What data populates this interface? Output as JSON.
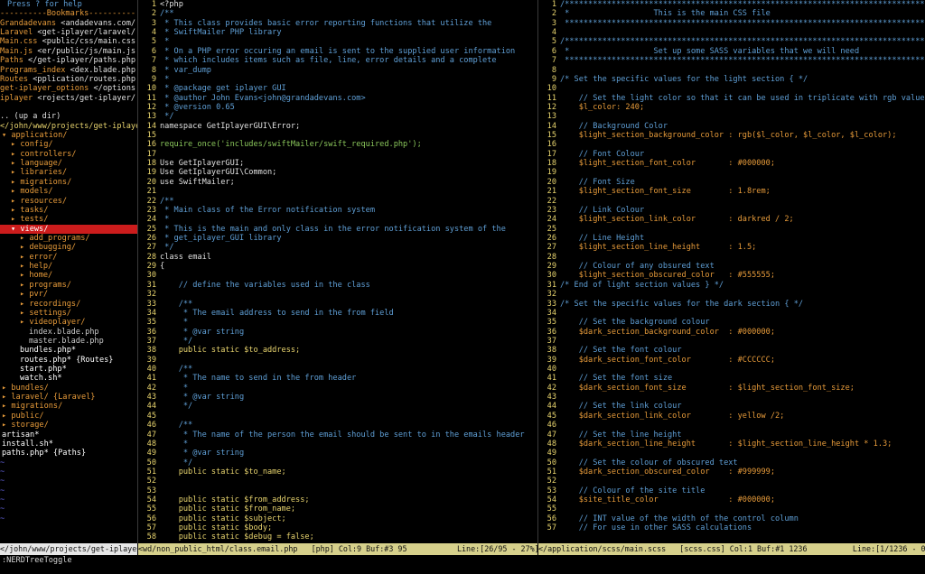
{
  "left_pane": {
    "help": "Press ? for help",
    "bookmarks_header": "----------Bookmarks----------",
    "bookmarks": [
      {
        "name": "Grandadevans",
        "path": "<andadevans.com/"
      },
      {
        "name": "Laravel",
        "path": "<get-iplayer/laravel/"
      },
      {
        "name": "Main.css",
        "path": "<public/css/main.css"
      },
      {
        "name": "Main.js",
        "path": "<er/public/js/main.js"
      },
      {
        "name": "Paths",
        "path": "</get-iplayer/paths.php"
      },
      {
        "name": "Programs_index",
        "path": "<dex.blade.php"
      },
      {
        "name": "Routes",
        "path": "<pplication/routes.php"
      },
      {
        "name": "get-iplayer_options",
        "path": "</options"
      },
      {
        "name": "iplayer",
        "path": "<rojects/get-iplayer/"
      }
    ],
    "up_dir": ".. (up a dir)",
    "cwd": "</john/www/projects/get-iplayer/",
    "tree": [
      {
        "text": "▾ application/",
        "indent": 0,
        "kind": "dir"
      },
      {
        "text": "▸ config/",
        "indent": 1,
        "kind": "dir"
      },
      {
        "text": "▸ controllers/",
        "indent": 1,
        "kind": "dir"
      },
      {
        "text": "▸ language/",
        "indent": 1,
        "kind": "dir"
      },
      {
        "text": "▸ libraries/",
        "indent": 1,
        "kind": "dir"
      },
      {
        "text": "▸ migrations/",
        "indent": 1,
        "kind": "dir"
      },
      {
        "text": "▸ models/",
        "indent": 1,
        "kind": "dir"
      },
      {
        "text": "▸ resources/",
        "indent": 1,
        "kind": "dir"
      },
      {
        "text": "▸ tasks/",
        "indent": 1,
        "kind": "dir"
      },
      {
        "text": "▸ tests/",
        "indent": 1,
        "kind": "dir"
      },
      {
        "text": "▾ views/",
        "indent": 1,
        "kind": "dir",
        "selected": true
      },
      {
        "text": "▸ add_programs/",
        "indent": 2,
        "kind": "dir"
      },
      {
        "text": "▸ debugging/",
        "indent": 2,
        "kind": "dir"
      },
      {
        "text": "▸ error/",
        "indent": 2,
        "kind": "dir"
      },
      {
        "text": "▸ help/",
        "indent": 2,
        "kind": "dir"
      },
      {
        "text": "▸ home/",
        "indent": 2,
        "kind": "dir"
      },
      {
        "text": "▸ programs/",
        "indent": 2,
        "kind": "dir"
      },
      {
        "text": "▸ pvr/",
        "indent": 2,
        "kind": "dir"
      },
      {
        "text": "▸ recordings/",
        "indent": 2,
        "kind": "dir"
      },
      {
        "text": "▸ settings/",
        "indent": 2,
        "kind": "dir"
      },
      {
        "text": "▸ videoplayer/",
        "indent": 2,
        "kind": "dir"
      },
      {
        "text": "index.blade.php",
        "indent": 3,
        "kind": "file"
      },
      {
        "text": "master.blade.php",
        "indent": 3,
        "kind": "file"
      },
      {
        "text": "bundles.php*",
        "indent": 2,
        "kind": "exec"
      },
      {
        "text": "routes.php* {Routes}",
        "indent": 2,
        "kind": "exec"
      },
      {
        "text": "start.php*",
        "indent": 2,
        "kind": "exec"
      },
      {
        "text": "watch.sh*",
        "indent": 2,
        "kind": "exec"
      },
      {
        "text": "▸ bundles/",
        "indent": 0,
        "kind": "dir"
      },
      {
        "text": "▸ laravel/ {Laravel}",
        "indent": 0,
        "kind": "dir"
      },
      {
        "text": "▸ migrations/",
        "indent": 0,
        "kind": "dir"
      },
      {
        "text": "▸ public/",
        "indent": 0,
        "kind": "dir"
      },
      {
        "text": "▸ storage/",
        "indent": 0,
        "kind": "dir"
      },
      {
        "text": "artisan*",
        "indent": 0,
        "kind": "exec"
      },
      {
        "text": "install.sh*",
        "indent": 0,
        "kind": "exec"
      },
      {
        "text": "paths.php* {Paths}",
        "indent": 0,
        "kind": "exec"
      }
    ],
    "tildes": 7
  },
  "middle_pane": {
    "lines": [
      {
        "n": "1",
        "c": "<?php",
        "s": "white"
      },
      {
        "n": "2",
        "c": "/**",
        "s": "blue"
      },
      {
        "n": "3",
        "c": " * This class provides basic error reporting functions that utilize the",
        "s": "blue"
      },
      {
        "n": "4",
        "c": " * SwiftMailer PHP library",
        "s": "blue"
      },
      {
        "n": "5",
        "c": " *",
        "s": "blue"
      },
      {
        "n": "6",
        "c": " * On a PHP error occuring an email is sent to the supplied user information",
        "s": "blue"
      },
      {
        "n": "7",
        "c": " * which includes items such as file, line, error details and a complete",
        "s": "blue"
      },
      {
        "n": "8",
        "c": " * var_dump",
        "s": "blue"
      },
      {
        "n": "9",
        "c": " *",
        "s": "blue"
      },
      {
        "n": "10",
        "c": " * @package get iplayer GUI",
        "s": "blue"
      },
      {
        "n": "11",
        "c": " * @author John Evans<john@grandadevans.com>",
        "s": "blue"
      },
      {
        "n": "12",
        "c": " * @version 0.65",
        "s": "blue"
      },
      {
        "n": "13",
        "c": " */",
        "s": "blue"
      },
      {
        "n": "14",
        "c": "namespace GetIplayerGUI\\Error;",
        "s": "white"
      },
      {
        "n": "15",
        "c": "",
        "s": "white"
      },
      {
        "n": "16",
        "c": "require_once('includes/swiftMailer/swift_required.php');",
        "s": "green"
      },
      {
        "n": "17",
        "c": "",
        "s": "white"
      },
      {
        "n": "18",
        "c": "Use GetIplayerGUI;",
        "s": "white"
      },
      {
        "n": "19",
        "c": "Use GetIplayerGUI\\Common;",
        "s": "white"
      },
      {
        "n": "20",
        "c": "use SwiftMailer;",
        "s": "white"
      },
      {
        "n": "21",
        "c": "",
        "s": "white"
      },
      {
        "n": "22",
        "c": "/**",
        "s": "blue"
      },
      {
        "n": "23",
        "c": " * Main class of the Error notification system",
        "s": "blue"
      },
      {
        "n": "24",
        "c": " *",
        "s": "blue"
      },
      {
        "n": "25",
        "c": " * This is the main and only class in the error notification system of the",
        "s": "blue"
      },
      {
        "n": "26",
        "c": " * get_iplayer_GUI library",
        "s": "blue"
      },
      {
        "n": "27",
        "c": " */",
        "s": "blue"
      },
      {
        "n": "28",
        "c": "class email",
        "s": "white"
      },
      {
        "n": "29",
        "c": "{",
        "s": "white"
      },
      {
        "n": "30",
        "c": "",
        "s": "white"
      },
      {
        "n": "31",
        "c": "    // define the variables used in the class",
        "s": "blue"
      },
      {
        "n": "32",
        "c": "",
        "s": "white"
      },
      {
        "n": "33",
        "c": "    /**",
        "s": "blue"
      },
      {
        "n": "34",
        "c": "     * The email address to send in the from field",
        "s": "blue"
      },
      {
        "n": "35",
        "c": "     *",
        "s": "blue"
      },
      {
        "n": "36",
        "c": "     * @var string",
        "s": "blue"
      },
      {
        "n": "37",
        "c": "     */",
        "s": "blue"
      },
      {
        "n": "38",
        "c": "    public static $to_address;",
        "s": "yellow"
      },
      {
        "n": "39",
        "c": "",
        "s": "white"
      },
      {
        "n": "40",
        "c": "    /**",
        "s": "blue"
      },
      {
        "n": "41",
        "c": "     * The name to send in the from header",
        "s": "blue"
      },
      {
        "n": "42",
        "c": "     *",
        "s": "blue"
      },
      {
        "n": "43",
        "c": "     * @var string",
        "s": "blue"
      },
      {
        "n": "44",
        "c": "     */",
        "s": "blue"
      },
      {
        "n": "45",
        "c": "",
        "s": "white"
      },
      {
        "n": "46",
        "c": "    /**",
        "s": "blue"
      },
      {
        "n": "47",
        "c": "     * The name of the person the email should be sent to in the emails header",
        "s": "blue"
      },
      {
        "n": "48",
        "c": "     *",
        "s": "blue"
      },
      {
        "n": "49",
        "c": "     * @var string",
        "s": "blue"
      },
      {
        "n": "50",
        "c": "     */",
        "s": "blue"
      },
      {
        "n": "51",
        "c": "    public static $to_name;",
        "s": "yellow"
      },
      {
        "n": "52",
        "c": "",
        "s": "white"
      },
      {
        "n": "53",
        "c": "",
        "s": "white"
      },
      {
        "n": "54",
        "c": "    public static $from_address;",
        "s": "yellow"
      },
      {
        "n": "55",
        "c": "    public static $from_name;",
        "s": "yellow"
      },
      {
        "n": "56",
        "c": "    public static $subject;",
        "s": "yellow"
      },
      {
        "n": "57",
        "c": "    public static $body;",
        "s": "yellow"
      },
      {
        "n": "58",
        "c": "    public static $debug = false;",
        "s": "yellow"
      }
    ]
  },
  "right_pane": {
    "lines": [
      {
        "n": "1",
        "c": "/*****************************************************************************",
        "s": "blue"
      },
      {
        "n": "2",
        "c": " *                  This is the main CSS file",
        "s": "blue"
      },
      {
        "n": "3",
        "c": " *****************************************************************************/",
        "s": "blue"
      },
      {
        "n": "4",
        "c": "",
        "s": "white"
      },
      {
        "n": "5",
        "c": "/*****************************************************************************",
        "s": "blue"
      },
      {
        "n": "6",
        "c": " *                  Set up some SASS variables that we will need",
        "s": "blue"
      },
      {
        "n": "7",
        "c": " *****************************************************************************/",
        "s": "blue"
      },
      {
        "n": "8",
        "c": "",
        "s": "white"
      },
      {
        "n": "9",
        "c": "/* Set the specific values for the light section { */",
        "s": "blue"
      },
      {
        "n": "10",
        "c": "",
        "s": "white"
      },
      {
        "n": "11",
        "c": "    // Set the light color so that it can be used in triplicate with rgb values",
        "s": "blue"
      },
      {
        "n": "12",
        "c": "    $l_color: 240;",
        "s": "orange"
      },
      {
        "n": "13",
        "c": "",
        "s": "white"
      },
      {
        "n": "14",
        "c": "    // Background Color",
        "s": "blue"
      },
      {
        "n": "15",
        "c": "    $light_section_background_color : rgb($l_color, $l_color, $l_color);",
        "s": "orange"
      },
      {
        "n": "16",
        "c": "",
        "s": "white"
      },
      {
        "n": "17",
        "c": "    // Font Colour",
        "s": "blue"
      },
      {
        "n": "18",
        "c": "    $light_section_font_color       : #000000;",
        "s": "orange"
      },
      {
        "n": "19",
        "c": "",
        "s": "white"
      },
      {
        "n": "20",
        "c": "    // Font Size",
        "s": "blue"
      },
      {
        "n": "21",
        "c": "    $light_section_font_size        : 1.8rem;",
        "s": "orange"
      },
      {
        "n": "22",
        "c": "",
        "s": "white"
      },
      {
        "n": "23",
        "c": "    // Link Colour",
        "s": "blue"
      },
      {
        "n": "24",
        "c": "    $light_section_link_color       : darkred / 2;",
        "s": "orange"
      },
      {
        "n": "25",
        "c": "",
        "s": "white"
      },
      {
        "n": "26",
        "c": "    // Line Height",
        "s": "blue"
      },
      {
        "n": "27",
        "c": "    $light_section_line_height      : 1.5;",
        "s": "orange"
      },
      {
        "n": "28",
        "c": "",
        "s": "white"
      },
      {
        "n": "29",
        "c": "    // Colour of any obsured text",
        "s": "blue"
      },
      {
        "n": "30",
        "c": "    $light_section_obscured_color   : #555555;",
        "s": "orange"
      },
      {
        "n": "31",
        "c": "/* End of light section values } */",
        "s": "blue"
      },
      {
        "n": "32",
        "c": "",
        "s": "white"
      },
      {
        "n": "33",
        "c": "/* Set the specific values for the dark section { */",
        "s": "blue"
      },
      {
        "n": "34",
        "c": "",
        "s": "white"
      },
      {
        "n": "35",
        "c": "    // Set the background colour",
        "s": "blue"
      },
      {
        "n": "36",
        "c": "    $dark_section_background_color  : #000000;",
        "s": "orange"
      },
      {
        "n": "37",
        "c": "",
        "s": "white"
      },
      {
        "n": "38",
        "c": "    // Set the font colour",
        "s": "blue"
      },
      {
        "n": "39",
        "c": "    $dark_section_font_color        : #CCCCCC;",
        "s": "orange"
      },
      {
        "n": "40",
        "c": "",
        "s": "white"
      },
      {
        "n": "41",
        "c": "    // Set the font size",
        "s": "blue"
      },
      {
        "n": "42",
        "c": "    $dark_section_font_size         : $light_section_font_size;",
        "s": "orange"
      },
      {
        "n": "43",
        "c": "",
        "s": "white"
      },
      {
        "n": "44",
        "c": "    // Set the link colour",
        "s": "blue"
      },
      {
        "n": "45",
        "c": "    $dark_section_link_color        : yellow /2;",
        "s": "orange"
      },
      {
        "n": "46",
        "c": "",
        "s": "white"
      },
      {
        "n": "47",
        "c": "    // Set the line height",
        "s": "blue"
      },
      {
        "n": "48",
        "c": "    $dark_section_line_height       : $light_section_line_height * 1.3;",
        "s": "orange"
      },
      {
        "n": "49",
        "c": "",
        "s": "white"
      },
      {
        "n": "50",
        "c": "    // Set the colour of obscured text",
        "s": "blue"
      },
      {
        "n": "51",
        "c": "    $dark_section_obscured_color    : #999999;",
        "s": "orange"
      },
      {
        "n": "52",
        "c": "",
        "s": "white"
      },
      {
        "n": "53",
        "c": "    // Colour of the site title",
        "s": "blue"
      },
      {
        "n": "54",
        "c": "    $site_title_color               : #000000;",
        "s": "orange"
      },
      {
        "n": "55",
        "c": "",
        "s": "white"
      },
      {
        "n": "56",
        "c": "    // INT value of the width of the control column",
        "s": "blue"
      },
      {
        "n": "57",
        "c": "    // For use in other SASS calculations",
        "s": "blue"
      }
    ]
  },
  "status": {
    "left": "</john/www/projects/get-iplayer",
    "middle": "<wd/non_public_html/class.email.php   [php] Col:9 Buf:#3 95           Line:[26/95 - 27%]",
    "right": "</application/scss/main.scss   [scss.css] Col:1 Buf:#1 1236          Line:[1/1236 - 0%]"
  },
  "command_line": ":NERDTreeToggle",
  "colors": {
    "comment": "#5f9fd6",
    "variable": "#e79b3a",
    "line_number": "#e8d46e",
    "selection": "#cc1c1c",
    "statusbar": "#d6d08b"
  }
}
